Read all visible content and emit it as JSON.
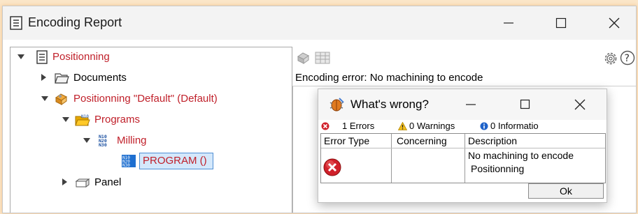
{
  "window": {
    "title": "Encoding Report"
  },
  "tree": {
    "root": "Positionning",
    "documents": "Documents",
    "positionning_default": "Positionning \"Default\" (Default)",
    "programs": "Programs",
    "milling": "Milling",
    "program": "PROGRAM ()",
    "panel": "Panel"
  },
  "panel": {
    "message": "Encoding error: No machining to encode"
  },
  "dialog": {
    "title": "What's wrong?",
    "status": {
      "errors": "1 Errors",
      "warnings": "0 Warnings",
      "information": "0 Informatio"
    },
    "columns": [
      "Error Type",
      "Concerning",
      "Description"
    ],
    "rows": [
      {
        "description": [
          "No machining to encode",
          "Positionning"
        ]
      }
    ],
    "ok_label": "Ok"
  },
  "colors": {
    "tree_red": "#c0202a",
    "selection_bg": "#d4e8fb",
    "folder": "#f5b400",
    "error": "#d0202a"
  }
}
